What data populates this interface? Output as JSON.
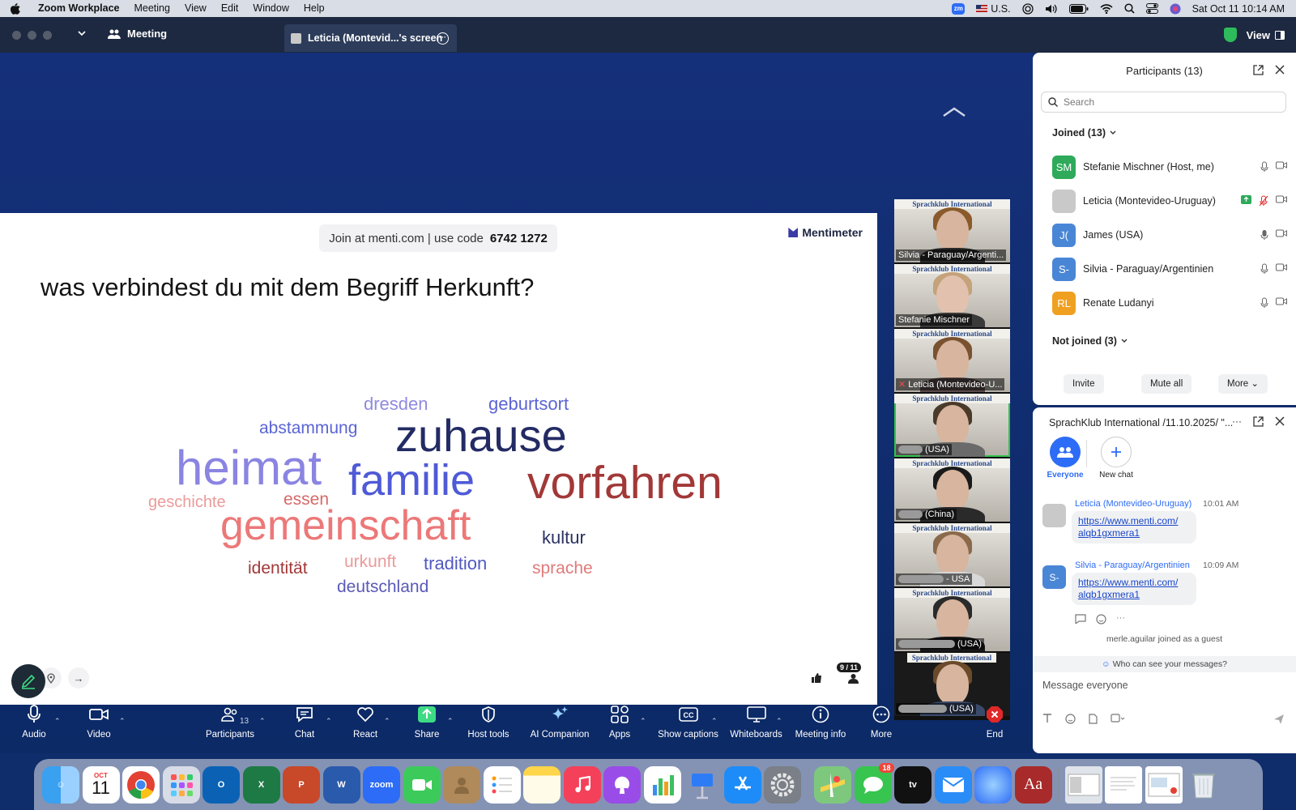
{
  "menubar": {
    "app": "Zoom Workplace",
    "items": [
      "Meeting",
      "View",
      "Edit",
      "Window",
      "Help"
    ],
    "input_source": "U.S.",
    "clock": "Sat Oct 11  10:14 AM"
  },
  "titlebar": {
    "meeting_tab": "Meeting",
    "share_tab": "Leticia (Montevid...'s screen",
    "view_label": "View"
  },
  "slide": {
    "join_text": "Join at menti.com | use code",
    "join_code": "6742 1272",
    "brand": "Mentimeter",
    "question": "was verbindest du mit dem Begriff Herkunft?",
    "vote_count": "9 / 11",
    "word_cloud": [
      {
        "word": "dresden",
        "color": "#8f8ae0"
      },
      {
        "word": "geburtsort",
        "color": "#5a64d4"
      },
      {
        "word": "abstammung",
        "color": "#5a64d4"
      },
      {
        "word": "zuhause",
        "color": "#232b64"
      },
      {
        "word": "heimat",
        "color": "#8a84e2"
      },
      {
        "word": "familie",
        "color": "#4e5ad6"
      },
      {
        "word": "vorfahren",
        "color": "#a23838"
      },
      {
        "word": "geschichte",
        "color": "#ec9a9a"
      },
      {
        "word": "essen",
        "color": "#d86868"
      },
      {
        "word": "gemeinschaft",
        "color": "#ec7878"
      },
      {
        "word": "kultur",
        "color": "#2b3262"
      },
      {
        "word": "urkunft",
        "color": "#ec9a9a"
      },
      {
        "word": "tradition",
        "color": "#5058c2"
      },
      {
        "word": "identität",
        "color": "#a23838"
      },
      {
        "word": "sprache",
        "color": "#e07a7a"
      },
      {
        "word": "deutschland",
        "color": "#5a5ab8"
      }
    ]
  },
  "gallery": {
    "tiles": [
      {
        "name": "Silvia - Paraguay/Argenti...",
        "banner": "Sprachklub International"
      },
      {
        "name": "Stefanie Mischner",
        "banner": "Sprachklub International"
      },
      {
        "name": "Leticia (Montevideo-U...",
        "banner": "Sprachklub International"
      },
      {
        "name": "(USA)",
        "banner": "Sprachklub International"
      },
      {
        "name": "(China)",
        "banner": "Sprachklub International"
      },
      {
        "name": "- USA",
        "banner": "Sprachklub International"
      },
      {
        "name": "(USA)",
        "banner": "Sprachklub International"
      },
      {
        "name": "(USA)",
        "banner": "Sprachklub International"
      }
    ]
  },
  "toolbar": {
    "audio": "Audio",
    "video": "Video",
    "participants": "Participants",
    "participants_count": "13",
    "chat": "Chat",
    "react": "React",
    "share": "Share",
    "host_tools": "Host tools",
    "ai_companion": "AI Companion",
    "apps": "Apps",
    "captions": "Show captions",
    "whiteboards": "Whiteboards",
    "meeting_info": "Meeting info",
    "more": "More",
    "end": "End"
  },
  "participants_panel": {
    "title": "Participants (13)",
    "search_placeholder": "Search",
    "joined_label": "Joined (13)",
    "not_joined_label": "Not joined (3)",
    "people": [
      {
        "initials": "SM",
        "name": "Stefanie Mischner (Host, me)",
        "color": "#2eaa5a"
      },
      {
        "initials": "",
        "name": "Leticia (Montevideo-Uruguay)",
        "color": "#c9c9c9"
      },
      {
        "initials": "J(",
        "name": "James (USA)",
        "color": "#4a86d6"
      },
      {
        "initials": "S-",
        "name": "Silvia - Paraguay/Argentinien",
        "color": "#4a86d6"
      },
      {
        "initials": "RL",
        "name": "Renate Ludanyi",
        "color": "#f0a020"
      }
    ],
    "invite": "Invite",
    "mute_all": "Mute all",
    "more": "More"
  },
  "chat_panel": {
    "title": "SprachKlub International /11.10.2025/ \"...",
    "everyone": "Everyone",
    "new_chat": "New chat",
    "messages": [
      {
        "sender": "Leticia (Montevideo-Uruguay)",
        "time": "10:01 AM",
        "text": "https://www.menti.com/ alqb1gxmera1",
        "initials": ""
      },
      {
        "sender": "Silvia - Paraguay/Argentinien",
        "time": "10:09 AM",
        "text": "https://www.menti.com/ alqb1gxmera1",
        "initials": "S-"
      }
    ],
    "system": "merle.aguilar joined as a guest",
    "who_can_see": "Who can see your messages?",
    "input_placeholder": "Message everyone"
  },
  "dock": {
    "calendar_month": "OCT",
    "calendar_day": "11",
    "messages_badge": "18",
    "zoom_label": "zoom",
    "dictionary_label": "Aa"
  }
}
